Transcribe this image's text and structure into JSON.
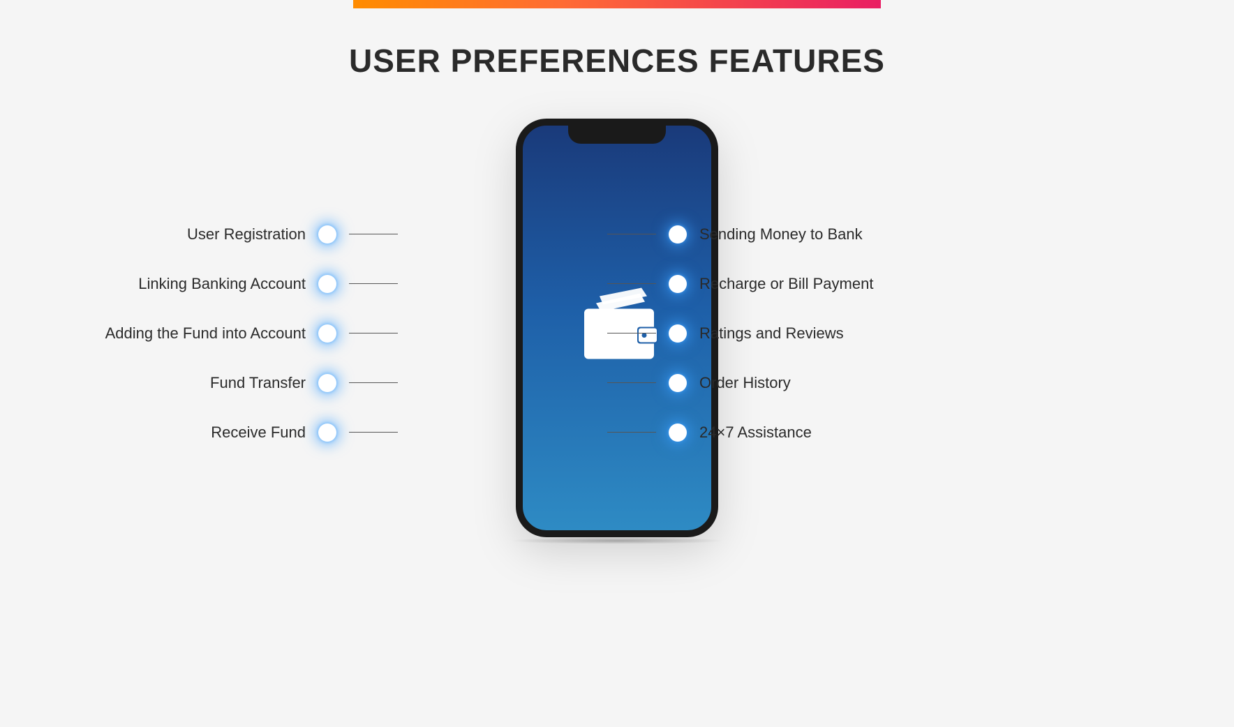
{
  "title": "USER PREFERENCES FEATURES",
  "left_features": [
    "User Registration",
    "Linking Banking Account",
    "Adding the Fund into Account",
    "Fund Transfer",
    "Receive Fund"
  ],
  "right_features": [
    "Sending Money to Bank",
    "Recharge or Bill Payment",
    "Ratings and Reviews",
    "Order History",
    "24×7 Assistance"
  ],
  "icon_name": "wallet-icon"
}
